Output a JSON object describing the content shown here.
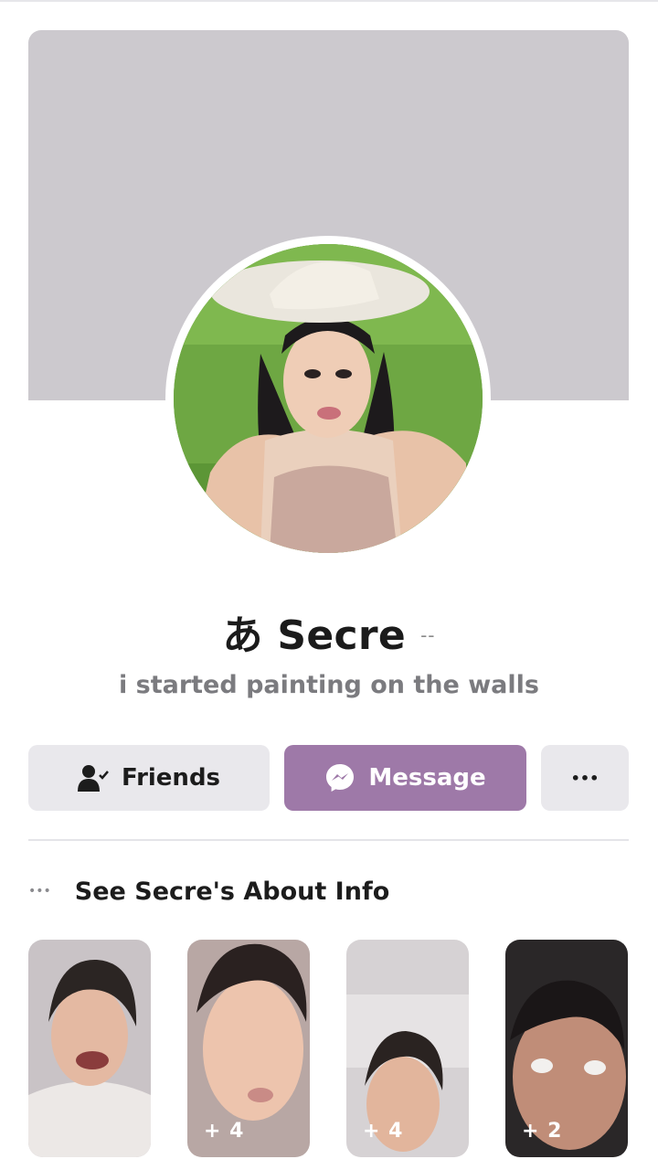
{
  "profile": {
    "name": "あ Secre",
    "name_suffix": "--",
    "bio": "i started painting on the walls"
  },
  "actions": {
    "friends_label": "Friends",
    "message_label": "Message",
    "more_label": "•••"
  },
  "about": {
    "dots": "•••",
    "label": "See Secre's About Info"
  },
  "stories": [
    {
      "count": ""
    },
    {
      "count": "+ 4"
    },
    {
      "count": "+ 4"
    },
    {
      "count": "+ 2"
    }
  ],
  "colors": {
    "cover": "#ccc9ce",
    "message_button": "#9e79a8",
    "secondary_button": "#e9e8ec",
    "bio_text": "#7b7b7f"
  },
  "icons": {
    "friends": "person-check-icon",
    "message": "messenger-icon",
    "more": "more-dots-icon",
    "about": "more-dots-icon"
  }
}
